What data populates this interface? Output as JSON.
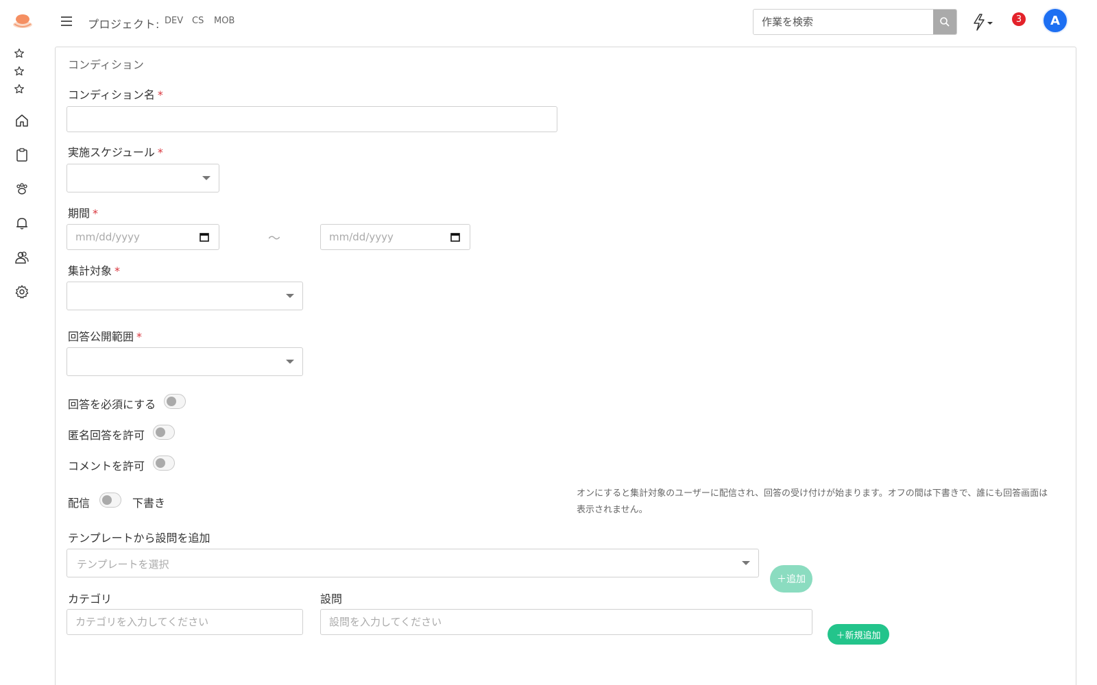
{
  "header": {
    "menu_icon": "hamburger-icon",
    "project_label": "プロジェクト:",
    "projects": [
      "DEV",
      "CS",
      "MOB"
    ],
    "search_placeholder": "作業を検索",
    "notification_count": "3",
    "avatar_initial": "A",
    "colors": {
      "badge": "#e3222a",
      "avatar": "#1d6ff2",
      "search_button": "#aaaaaa"
    }
  },
  "sidebar": {
    "favorites": [
      "star-icon",
      "star-icon",
      "star-icon"
    ],
    "nav": [
      "home-icon",
      "clipboard-icon",
      "paw-icon",
      "bell-icon",
      "users-icon",
      "gear-icon"
    ],
    "help_label": "?"
  },
  "form": {
    "card_title": "コンディション",
    "condition_name": {
      "label": "コンディション名",
      "required": "*",
      "value": ""
    },
    "schedule": {
      "label": "実施スケジュール",
      "required": "*",
      "value": ""
    },
    "period": {
      "label": "期間",
      "required": "*",
      "start_placeholder": "mm/dd/yyyy",
      "end_placeholder": "mm/dd/yyyy",
      "separator": "～"
    },
    "target": {
      "label": "集計対象",
      "required": "*",
      "value": ""
    },
    "scope": {
      "label": "回答公開範囲",
      "required": "*",
      "value": ""
    },
    "toggles": {
      "require_answer": {
        "label": "回答を必須にする",
        "on": false
      },
      "allow_anonymous": {
        "label": "匿名回答を許可",
        "on": false
      },
      "allow_comment": {
        "label": "コメントを許可",
        "on": false
      }
    },
    "delivery": {
      "label_on": "配信",
      "label_off": "下書き",
      "on": false,
      "help": "オンにすると集計対象のユーザーに配信され、回答の受け付けが始まります。オフの間は下書きで、誰にも回答画面は表示されません。"
    },
    "template": {
      "label": "テンプレートから設問を追加",
      "placeholder": "テンプレートを選択",
      "add_button": "＋追加"
    },
    "category": {
      "label": "カテゴリ",
      "placeholder": "カテゴリを入力してください"
    },
    "question": {
      "label": "設問",
      "placeholder": "設問を入力してください"
    },
    "new_button": "＋新規追加",
    "colors": {
      "required": "#d9363e",
      "add_button": "#8bdcc0",
      "new_button": "#23c48b"
    }
  }
}
